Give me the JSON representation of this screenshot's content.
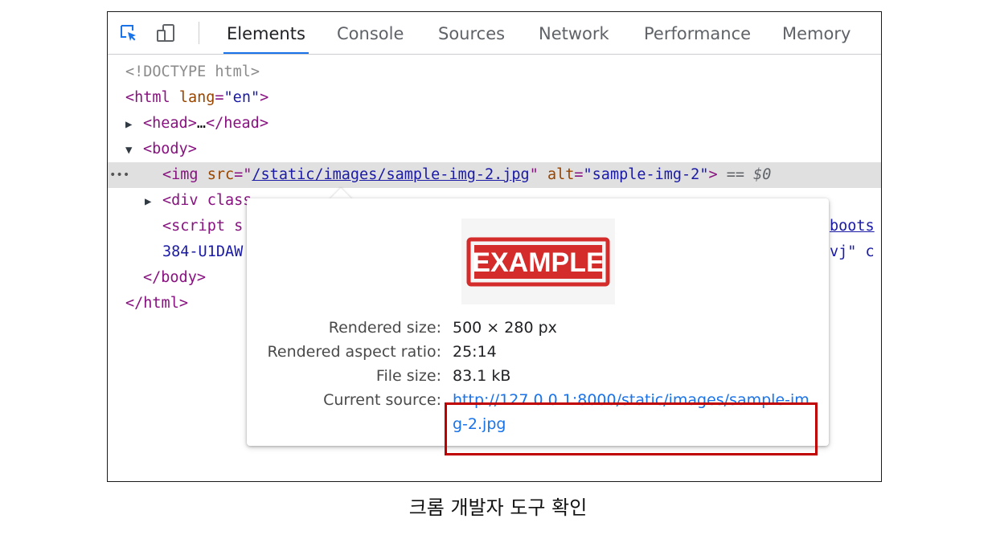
{
  "toolbar": {
    "tabs": [
      "Elements",
      "Console",
      "Sources",
      "Network",
      "Performance",
      "Memory"
    ],
    "active_tab": "Elements"
  },
  "dom": {
    "doctype": "<!DOCTYPE html>",
    "html_tag": "html",
    "lang_attr": "lang",
    "lang_val": "\"en\"",
    "head_tag": "head",
    "head_ellipsis": "…",
    "body_tag": "body",
    "img_tag": "img",
    "src_attr": "src",
    "src_val": "/static/images/sample-img-2.jpg",
    "alt_attr": "alt",
    "alt_val": "\"sample-img-2\"",
    "eq_ref": "== $0",
    "div_line": "<div class",
    "div_tail": "\"",
    "script_line": "<script s",
    "script_link_tail": "boots",
    "integrity_line": "384-U1DAW",
    "integrity_tail": "vj\" c",
    "close_body": "</body>",
    "close_html": "</html>"
  },
  "popup": {
    "thumbnail_text": "EXAMPLE",
    "rendered_size_label": "Rendered size:",
    "rendered_size_value": "500 × 280 px",
    "aspect_ratio_label": "Rendered aspect ratio:",
    "aspect_ratio_value": "25:14",
    "file_size_label": "File size:",
    "file_size_value": "83.1 kB",
    "current_source_label": "Current source:",
    "current_source_value": "http://127.0.0.1:8000/static/images/sample-img-2.jpg"
  },
  "caption": "크롬 개발자 도구 확인",
  "colors": {
    "accent": "#1a73e8",
    "highlight_box": "#c00000",
    "tag": "#881280"
  }
}
